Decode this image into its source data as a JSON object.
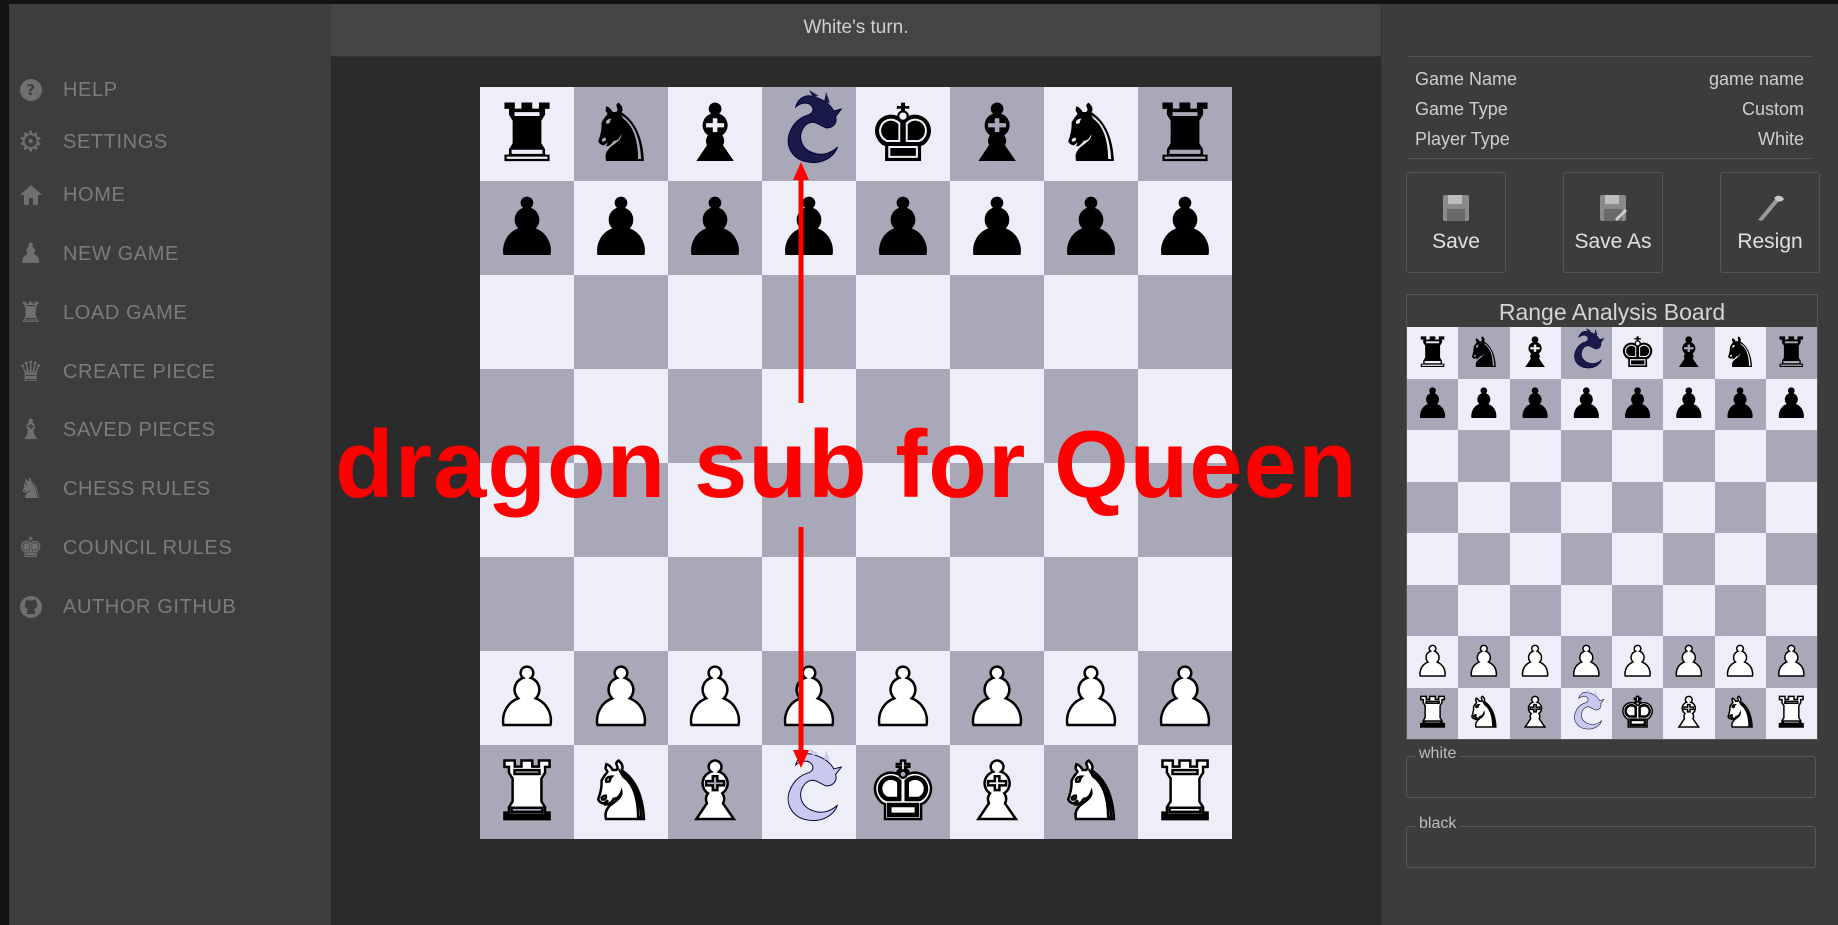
{
  "status": {
    "turn": "White's turn."
  },
  "sidebar": {
    "items": [
      {
        "label": "HELP",
        "icon": "help-circle-icon"
      },
      {
        "label": "SETTINGS",
        "icon": "gear-icon"
      },
      {
        "label": "HOME",
        "icon": "home-icon"
      },
      {
        "label": "NEW GAME",
        "icon": "pawn-icon"
      },
      {
        "label": "LOAD GAME",
        "icon": "rook-icon"
      },
      {
        "label": "CREATE PIECE",
        "icon": "queen-icon"
      },
      {
        "label": "SAVED PIECES",
        "icon": "bishop-icon"
      },
      {
        "label": "CHESS RULES",
        "icon": "knight-icon"
      },
      {
        "label": "COUNCIL RULES",
        "icon": "king-icon"
      },
      {
        "label": "AUTHOR GITHUB",
        "icon": "github-icon"
      }
    ]
  },
  "annotation": {
    "text": "dragon sub for Queen"
  },
  "game_info": {
    "rows": [
      {
        "label": "Game Name",
        "value": "game name"
      },
      {
        "label": "Game Type",
        "value": "Custom"
      },
      {
        "label": "Player Type",
        "value": "White"
      }
    ]
  },
  "toolbar": {
    "save_label": "Save",
    "save_as_label": "Save As",
    "resign_label": "Resign"
  },
  "range_board": {
    "title": "Range Analysis Board"
  },
  "captures": {
    "white_label": "white",
    "black_label": "black"
  },
  "board": {
    "ranks": [
      [
        "br",
        "bn",
        "bb",
        "bd",
        "bk",
        "bb",
        "bn",
        "br"
      ],
      [
        "bp",
        "bp",
        "bp",
        "bp",
        "bp",
        "bp",
        "bp",
        "bp"
      ],
      [
        "",
        "",
        "",
        "",
        "",
        "",
        "",
        ""
      ],
      [
        "",
        "",
        "",
        "",
        "",
        "",
        "",
        ""
      ],
      [
        "",
        "",
        "",
        "",
        "",
        "",
        "",
        ""
      ],
      [
        "",
        "",
        "",
        "",
        "",
        "",
        "",
        ""
      ],
      [
        "wp",
        "wp",
        "wp",
        "wp",
        "wp",
        "wp",
        "wp",
        "wp"
      ],
      [
        "wr",
        "wn",
        "wb",
        "wd",
        "wk",
        "wb",
        "wn",
        "wr"
      ]
    ]
  },
  "colors": {
    "light_square": "#eeeef8",
    "dark_square": "#a8a8b8",
    "annotation": "#ff0000",
    "dragon_black": "#1a1a4a",
    "dragon_white": "#c9c9ef"
  }
}
